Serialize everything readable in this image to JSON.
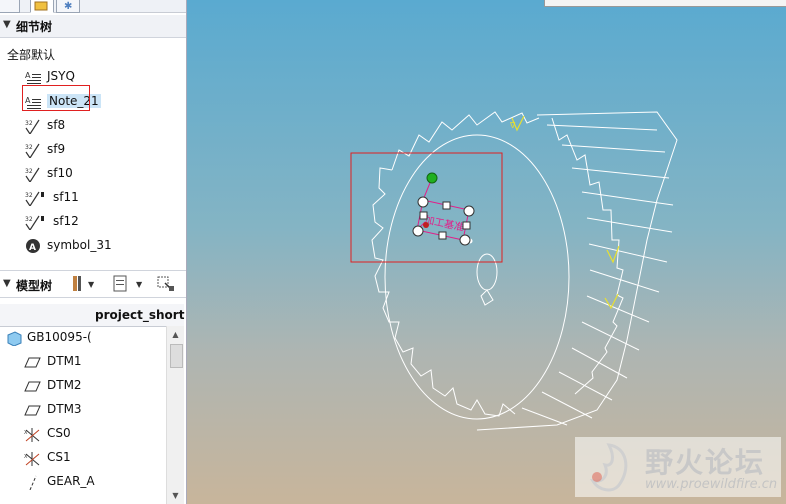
{
  "detail_tree": {
    "title": "细节树",
    "root": "全部默认",
    "items": [
      {
        "label": "JSYQ",
        "icon": "note-icon"
      },
      {
        "label": "Note_21",
        "icon": "note-icon",
        "selected": true
      },
      {
        "label": "sf8",
        "icon": "surface-finish-icon"
      },
      {
        "label": "sf9",
        "icon": "surface-finish-icon"
      },
      {
        "label": "sf10",
        "icon": "surface-finish-icon"
      },
      {
        "label": "sf11",
        "icon": "surface-finish-icon"
      },
      {
        "label": "sf12",
        "icon": "surface-finish-icon"
      },
      {
        "label": "symbol_31",
        "icon": "symbol-icon"
      }
    ]
  },
  "model_tree": {
    "title": "模型树",
    "column_header": "project_short",
    "items": [
      {
        "label": "GB10095-(",
        "icon": "part-icon"
      },
      {
        "label": "DTM1",
        "icon": "datum-plane-icon"
      },
      {
        "label": "DTM2",
        "icon": "datum-plane-icon"
      },
      {
        "label": "DTM3",
        "icon": "datum-plane-icon"
      },
      {
        "label": "CS0",
        "icon": "coordinate-system-icon"
      },
      {
        "label": "CS1",
        "icon": "coordinate-system-icon"
      },
      {
        "label": "GEAR_A",
        "icon": "datum-axis-icon"
      }
    ]
  },
  "viewport": {
    "annotation_text": "加工基准"
  },
  "watermark": {
    "title": "野火论坛",
    "url": "www.proewildfire.cn"
  },
  "colors": {
    "selection_red": "#e02020",
    "annotation_magenta": "#e0208a",
    "drag_handle_green": "#20b020"
  }
}
